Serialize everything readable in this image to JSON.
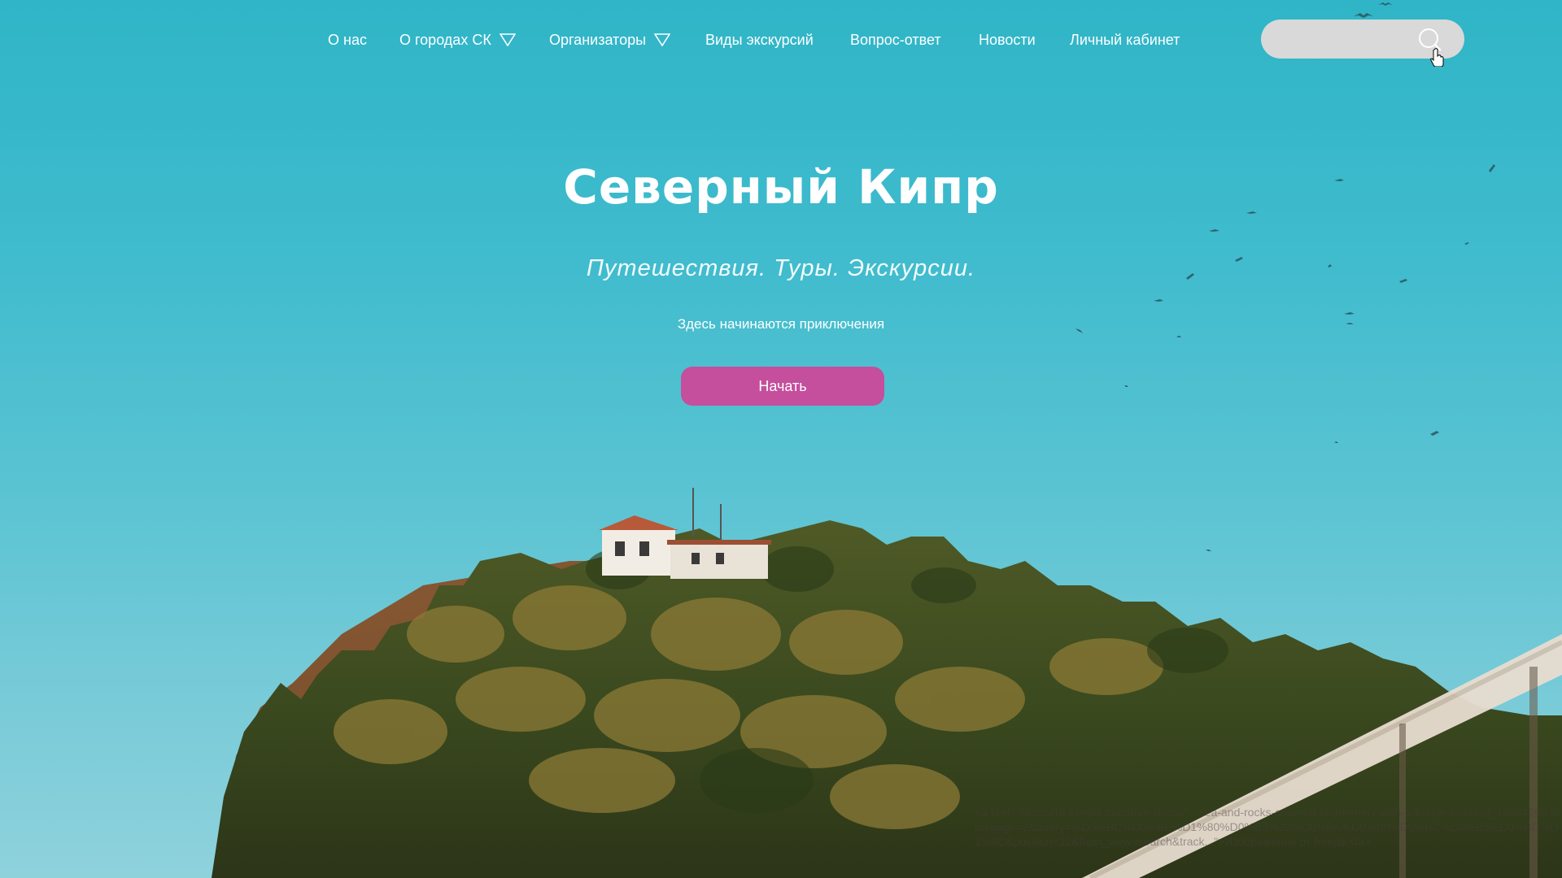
{
  "nav": {
    "items": [
      {
        "label": "О нас",
        "dropdown": false
      },
      {
        "label": "О городах СК",
        "dropdown": true
      },
      {
        "label": "Организаторы",
        "dropdown": true
      },
      {
        "label": "Виды экскурсий",
        "dropdown": false
      },
      {
        "label": "Вопрос-ответ",
        "dropdown": false
      },
      {
        "label": "Новости",
        "dropdown": false
      },
      {
        "label": "Личный кабинет",
        "dropdown": false
      }
    ]
  },
  "search": {
    "value": "",
    "placeholder": "",
    "icon": "search-icon"
  },
  "hero": {
    "title": "Северный Кипр",
    "subtitle": "Путешествия. Туры. Экскурсии.",
    "tagline": "Здесь начинаются приключения",
    "cta_label": "Начать"
  },
  "photo_credit": "<a href=\"https://ru.freepik.com/free-photo/...-sea-and-rocks-covered-in-greenery-with-a-bridge-in-brazil_10584268.htm#page=2&query=%D0%BC%D0%BE%D1%80%D0%B5%20%D0%BA%D0%B0%D0%BC%D0%B5%D0%BD%D1%8C&position=12&from_view=search&track...\">Изображение от freepik</a>",
  "colors": {
    "sky": "#40bcce",
    "accent": "#c54e9d",
    "search_bg": "#d9d9d9",
    "text": "#ffffff"
  }
}
